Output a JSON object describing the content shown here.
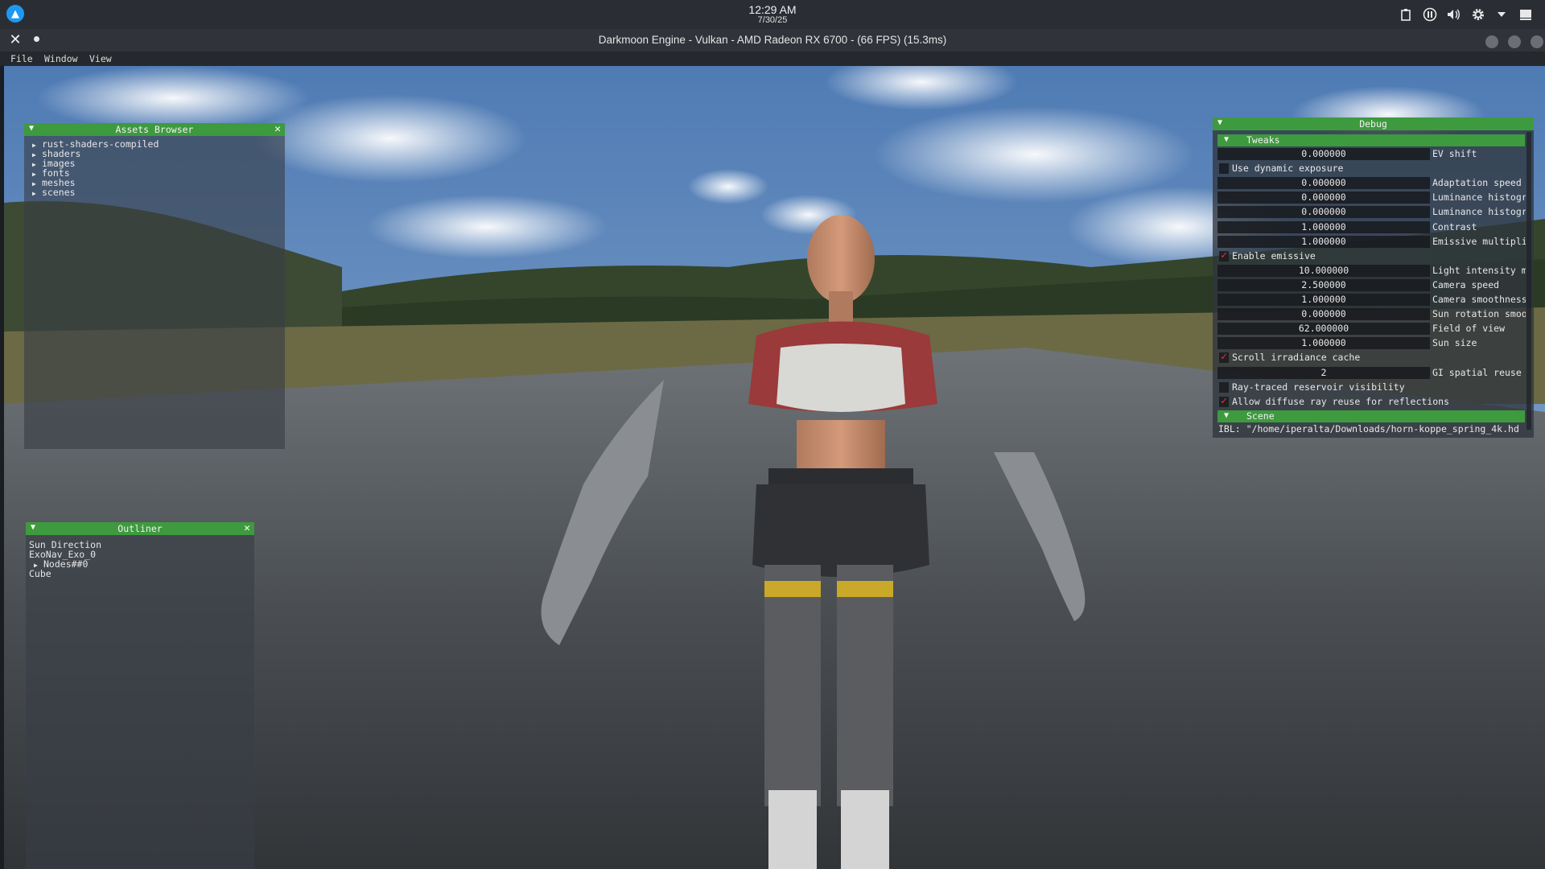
{
  "system": {
    "time": "12:29 AM",
    "date": "7/30/25",
    "tray_icons": [
      "clipboard-icon",
      "pause-icon",
      "volume-icon",
      "settings-icon",
      "chevron-down-icon",
      "notifications-icon"
    ]
  },
  "window": {
    "title": "Darkmoon Engine - Vulkan - AMD Radeon RX 6700 - (66 FPS) (15.3ms)"
  },
  "menu": [
    "File",
    "Window",
    "View"
  ],
  "assets_browser": {
    "title": "Assets Browser",
    "items": [
      "rust-shaders-compiled",
      "shaders",
      "images",
      "fonts",
      "meshes",
      "scenes"
    ]
  },
  "outliner": {
    "title": "Outliner",
    "items": [
      {
        "label": "Sun Direction",
        "arrow": false
      },
      {
        "label": "ExoNav_Exo_0",
        "arrow": false
      },
      {
        "label": "Nodes##0",
        "arrow": true
      },
      {
        "label": "Cube",
        "arrow": false
      }
    ]
  },
  "debug": {
    "title": "Debug",
    "tweaks_header": "Tweaks",
    "rows": [
      {
        "type": "num",
        "value": "0.000000",
        "label": "EV shift"
      },
      {
        "type": "check",
        "checked": false,
        "label": "Use dynamic exposure"
      },
      {
        "type": "num",
        "value": "0.000000",
        "label": "Adaptation speed"
      },
      {
        "type": "num",
        "value": "0.000000",
        "label": "Luminance histogr"
      },
      {
        "type": "num",
        "value": "0.000000",
        "label": "Luminance histogr"
      },
      {
        "type": "num",
        "value": "1.000000",
        "label": "Contrast"
      },
      {
        "type": "num",
        "value": "1.000000",
        "label": "Emissive multipli"
      },
      {
        "type": "check",
        "checked": true,
        "label": "Enable emissive"
      },
      {
        "type": "num",
        "value": "10.000000",
        "label": "Light intensity m"
      },
      {
        "type": "num",
        "value": "2.500000",
        "label": "Camera speed"
      },
      {
        "type": "num",
        "value": "1.000000",
        "label": "Camera smoothness"
      },
      {
        "type": "num",
        "value": "0.000000",
        "label": "Sun rotation smoo"
      },
      {
        "type": "num",
        "value": "62.000000",
        "label": "Field of view"
      },
      {
        "type": "num",
        "value": "1.000000",
        "label": "Sun size"
      },
      {
        "type": "check",
        "checked": true,
        "label": "Scroll irradiance cache"
      },
      {
        "type": "num",
        "value": "2",
        "label": "GI spatial reuse"
      },
      {
        "type": "check",
        "checked": false,
        "label": "Ray-traced reservoir visibility"
      },
      {
        "type": "check",
        "checked": true,
        "label": "Allow diffuse ray reuse for reflections"
      }
    ],
    "scene_header": "Scene",
    "ibl": "IBL: \"/home/iperalta/Downloads/horn-koppe_spring_4k.hd"
  },
  "colors": {
    "accent_green": "#3e9a3e",
    "check_red": "#e33333",
    "sys_logo_blue": "#1d99f3"
  }
}
